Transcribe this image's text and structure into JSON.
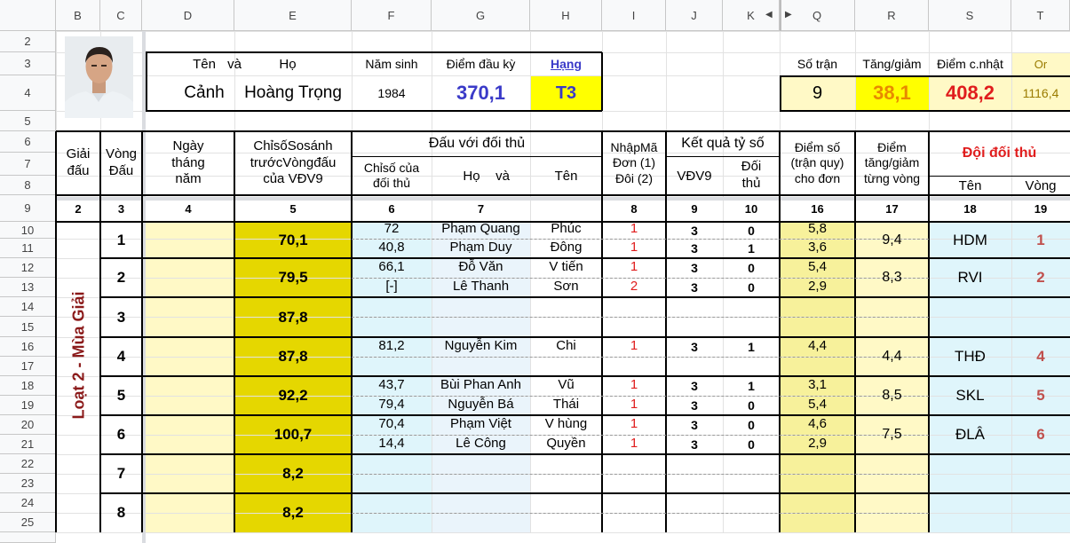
{
  "columns": [
    "B",
    "C",
    "D",
    "E",
    "F",
    "G",
    "H",
    "I",
    "J",
    "K",
    "Q",
    "R",
    "S",
    "T"
  ],
  "rows": [
    "2",
    "3",
    "4",
    "5",
    "6",
    "7",
    "8",
    "9",
    "10",
    "11",
    "12",
    "13",
    "14",
    "15",
    "16",
    "17",
    "18",
    "19",
    "20",
    "21",
    "22",
    "23",
    "24",
    "25"
  ],
  "player": {
    "name_label": "Tên",
    "and_label": "và",
    "surname_label": "Họ",
    "given_name": "Cảnh",
    "family_name": "Hoàng Trọng",
    "birth_year_label": "Năm sinh",
    "birth_year": "1984",
    "start_score_label": "Điểm đầu kỳ",
    "start_score": "370,1",
    "rank_label": "Hạng",
    "rank": "T3"
  },
  "summary": {
    "matches_label": "Số trận",
    "matches": "9",
    "change_label": "Tăng/giảm",
    "change": "38,1",
    "updated_label": "Điểm c.nhật",
    "updated": "408,2",
    "or_label": "Or",
    "or_value": "1116,4"
  },
  "headers": {
    "tournament": [
      "Giải",
      "đấu"
    ],
    "round": [
      "Vòng",
      "Đấu"
    ],
    "date": [
      "Ngày",
      "tháng",
      "năm"
    ],
    "compare": [
      "ChỉsốSosánh",
      "trướcVòngđấu",
      "của VĐV9"
    ],
    "vs_opponent": "Đấu với đối thủ",
    "opp_index": [
      "Chỉsố của",
      "đối thủ"
    ],
    "ho": "Họ",
    "va": "và",
    "ten": "Tên",
    "entry": [
      "NhậpMã",
      "Đơn (1)",
      "Đôi (2)"
    ],
    "result": "Kết quả tỷ số",
    "vdv9": "VĐV9",
    "opponent": [
      "Đối",
      "thủ"
    ],
    "points": [
      "Điểm số",
      "(trận quy)",
      "cho đơn"
    ],
    "delta": [
      "Điểm",
      "tăng/giảm",
      "từng vòng"
    ],
    "opp_team": "Đội đối thủ",
    "team_name": "Tên",
    "team_round": "Vòng"
  },
  "col_numbers": [
    "2",
    "3",
    "4",
    "5",
    "6",
    "7",
    "8",
    "9",
    "10",
    "16",
    "17",
    "18",
    "19"
  ],
  "season_label": "Loạt 2 - Mùa Giải",
  "rounds": [
    {
      "round": "1",
      "compare": "70,1",
      "delta": "9,4",
      "team": "HDM",
      "team_round": "1",
      "matches": [
        {
          "index": "72",
          "surname": "Phạm Quang",
          "name": "Phúc",
          "code": "1",
          "me": "3",
          "opp": "0",
          "points": "5,8"
        },
        {
          "index": "40,8",
          "surname": "Phạm Duy",
          "name": "Đông",
          "code": "1",
          "me": "3",
          "opp": "1",
          "points": "3,6"
        }
      ]
    },
    {
      "round": "2",
      "compare": "79,5",
      "delta": "8,3",
      "team": "RVI",
      "team_round": "2",
      "matches": [
        {
          "index": "66,1",
          "surname": "Đỗ Văn",
          "name": "V tiến",
          "code": "1",
          "me": "3",
          "opp": "0",
          "points": "5,4"
        },
        {
          "index": "[-]",
          "surname": "Lê Thanh",
          "name": "Sơn",
          "code": "2",
          "me": "3",
          "opp": "0",
          "points": "2,9"
        }
      ]
    },
    {
      "round": "3",
      "compare": "87,8",
      "delta": "",
      "team": "",
      "team_round": "",
      "matches": []
    },
    {
      "round": "4",
      "compare": "87,8",
      "delta": "4,4",
      "team": "THĐ",
      "team_round": "4",
      "matches": [
        {
          "index": "81,2",
          "surname": "Nguyễn Kim",
          "name": "Chi",
          "code": "1",
          "me": "3",
          "opp": "1",
          "points": "4,4"
        }
      ]
    },
    {
      "round": "5",
      "compare": "92,2",
      "delta": "8,5",
      "team": "SKL",
      "team_round": "5",
      "matches": [
        {
          "index": "43,7",
          "surname": "Bùi Phan Anh",
          "name": "Vũ",
          "code": "1",
          "me": "3",
          "opp": "1",
          "points": "3,1"
        },
        {
          "index": "79,4",
          "surname": "Nguyễn Bá",
          "name": "Thái",
          "code": "1",
          "me": "3",
          "opp": "0",
          "points": "5,4"
        }
      ]
    },
    {
      "round": "6",
      "compare": "100,7",
      "delta": "7,5",
      "team": "ĐLÂ",
      "team_round": "6",
      "matches": [
        {
          "index": "70,4",
          "surname": "Phạm Việt",
          "name": "V hùng",
          "code": "1",
          "me": "3",
          "opp": "0",
          "points": "4,6"
        },
        {
          "index": "14,4",
          "surname": "Lê Công",
          "name": "Quyền",
          "code": "1",
          "me": "3",
          "opp": "0",
          "points": "2,9"
        }
      ]
    },
    {
      "round": "7",
      "compare": "8,2",
      "delta": "",
      "team": "",
      "team_round": "",
      "matches": []
    },
    {
      "round": "8",
      "compare": "8,2",
      "delta": "",
      "team": "",
      "team_round": "",
      "matches": []
    }
  ],
  "colors": {
    "yellow_light": "#fff9c6",
    "yellow_mid": "#f7f19b",
    "yellow_bright": "#ffff00",
    "olive": "#e5d700",
    "cyan_light": "#dff5fb",
    "blue_value": "#3a3ac8",
    "red_value": "#e01d1d",
    "orange_value": "#e88a00",
    "maroon": "#8b1a1a"
  }
}
